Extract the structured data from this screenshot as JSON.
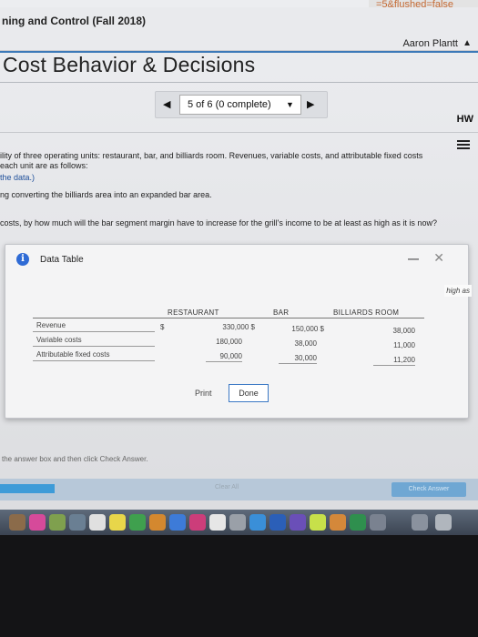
{
  "browser": {
    "url_fragment": "=5&flushed=false"
  },
  "course": {
    "title": "ning and Control (Fall 2018)",
    "user_name": "Aaron Plantt"
  },
  "page": {
    "title": "Cost Behavior & Decisions"
  },
  "pager": {
    "status": "5 of 6 (0 complete)",
    "prev_icon": "triangle-left-icon",
    "next_icon": "triangle-right-icon"
  },
  "header": {
    "hw_label": "HW"
  },
  "question": {
    "line1": "ility of three operating units: restaurant, bar, and billiards room. Revenues, variable costs, and attributable fixed costs",
    "line2": "each unit are as follows:",
    "line3": "the data.)",
    "line4": "ng converting the billiards area into an expanded bar area.",
    "line5": "costs, by how much will the bar segment margin have to increase for the grill's income to be at least as high as it is now?"
  },
  "dialog": {
    "title": "Data Table",
    "side_note": "high as",
    "print_label": "Print",
    "done_label": "Done",
    "columns": [
      "RESTAURANT",
      "BAR",
      "BILLIARDS ROOM"
    ],
    "rows": [
      {
        "label": "Revenue",
        "currency": "$",
        "values": [
          "330,000 $",
          "150,000 $",
          "38,000"
        ]
      },
      {
        "label": "Variable costs",
        "currency": "",
        "values": [
          "180,000",
          "38,000",
          "11,000"
        ]
      },
      {
        "label": "Attributable fixed costs",
        "currency": "",
        "values": [
          "90,000",
          "30,000",
          "11,200"
        ]
      }
    ]
  },
  "footer": {
    "hint": "the answer box and then click Check Answer.",
    "clear_label": "Clear All",
    "check_label": "Check Answer"
  },
  "colors": {
    "accent": "#3c79b8",
    "progress": "#3d9bd8",
    "info": "#2f6bd5"
  }
}
